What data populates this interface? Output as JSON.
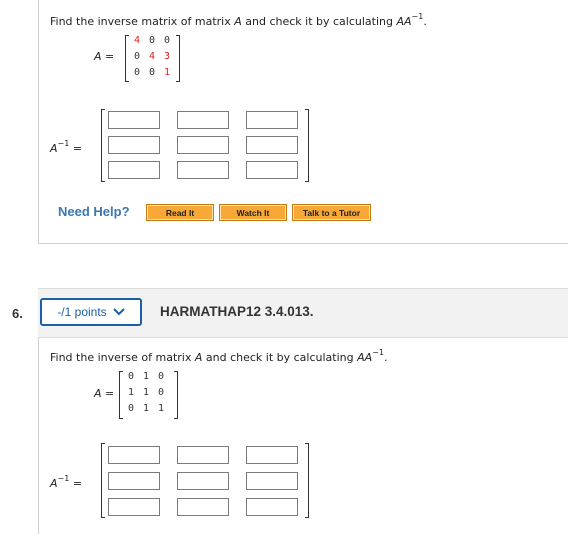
{
  "q5": {
    "prompt_pre": "Find the inverse matrix of matrix ",
    "prompt_mid": " and check it by calculating ",
    "var_a": "A",
    "var_aa": "AA",
    "sup_minus1": "−1",
    "period": ".",
    "matrix_label": "A",
    "equals": "=",
    "matrix": [
      [
        "4",
        "0",
        "0"
      ],
      [
        "0",
        "4",
        "3"
      ],
      [
        "0",
        "0",
        "1"
      ]
    ],
    "inverse_label": "A",
    "inverse_sup": "−1",
    "help": {
      "label": "Need Help?",
      "read_it": "Read It",
      "watch_it": "Watch It",
      "tutor": "Talk to a Tutor"
    }
  },
  "q6": {
    "number": "6.",
    "points": "-/1 points",
    "code": "HARMATHAP12 3.4.013.",
    "prompt_pre": "Find the inverse of matrix ",
    "prompt_mid": " and check it by calculating ",
    "var_a": "A",
    "var_aa": "AA",
    "sup_minus1": "−1",
    "period": ".",
    "matrix_label": "A",
    "equals": "=",
    "matrix": [
      [
        "0",
        "1",
        "0"
      ],
      [
        "1",
        "1",
        "0"
      ],
      [
        "0",
        "1",
        "1"
      ]
    ],
    "inverse_label": "A",
    "inverse_sup": "−1"
  },
  "colors": {
    "link_blue": "#1b5fa8",
    "help_blue": "#3a78b5",
    "button_orange": "#f7a836",
    "highlight_red": "#dd2222"
  },
  "icons": {
    "points_dropdown": "chevron-down-icon"
  }
}
